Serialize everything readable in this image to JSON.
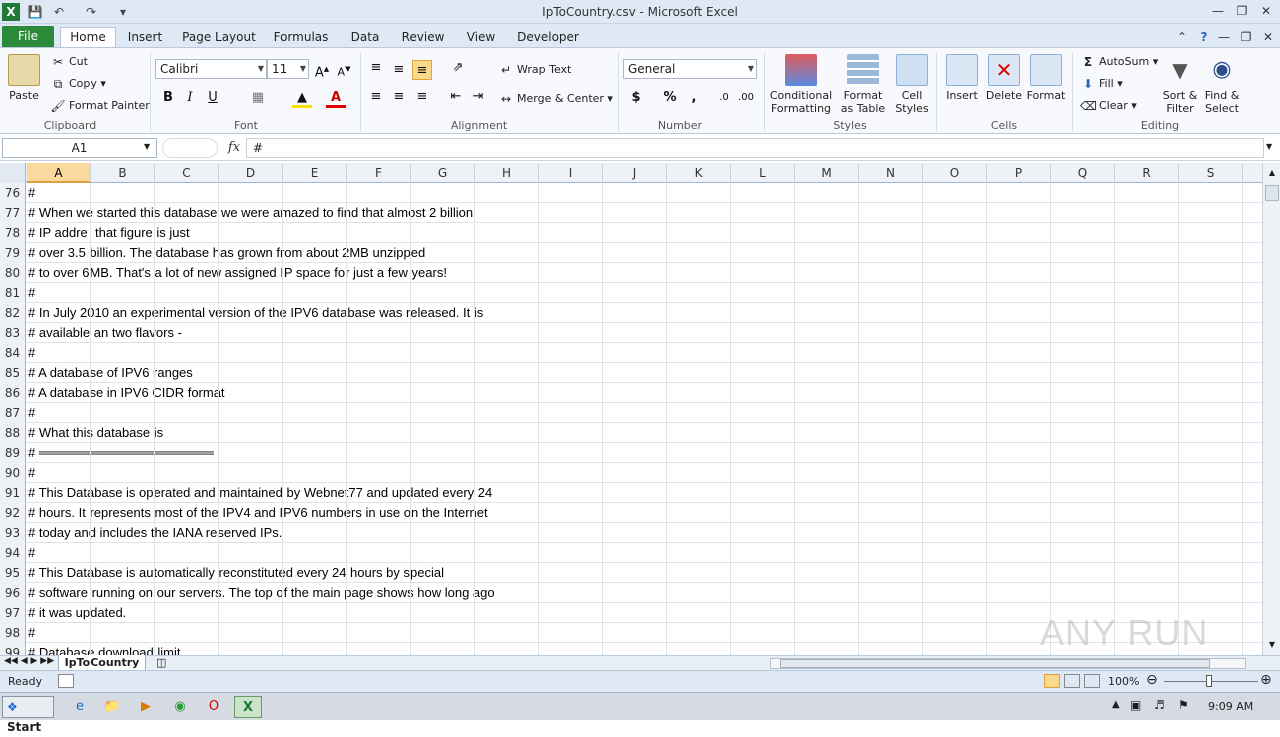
{
  "window": {
    "title": "IpToCountry.csv  -  Microsoft Excel"
  },
  "tabs": [
    {
      "label": "File"
    },
    {
      "label": "Home"
    },
    {
      "label": "Insert"
    },
    {
      "label": "Page Layout"
    },
    {
      "label": "Formulas"
    },
    {
      "label": "Data"
    },
    {
      "label": "Review"
    },
    {
      "label": "View"
    },
    {
      "label": "Developer"
    }
  ],
  "ribbon": {
    "clipboard": {
      "paste": "Paste",
      "cut": "Cut",
      "copy": "Copy",
      "format_painter": "Format Painter",
      "label": "Clipboard"
    },
    "font": {
      "name": "Calibri",
      "size": "11",
      "label": "Font"
    },
    "alignment": {
      "wrap_text": "Wrap Text",
      "merge_center": "Merge & Center",
      "label": "Alignment"
    },
    "number": {
      "format": "General",
      "label": "Number"
    },
    "styles": {
      "conditional": "Conditional",
      "conditional2": "Formatting",
      "format_as": "Format",
      "format_as2": "as Table",
      "cell": "Cell",
      "cell2": "Styles",
      "label": "Styles"
    },
    "cells": {
      "insert": "Insert",
      "delete": "Delete",
      "format": "Format",
      "label": "Cells"
    },
    "editing": {
      "autosum": "AutoSum",
      "fill": "Fill",
      "clear": "Clear",
      "sort": "Sort &",
      "sort2": "Filter",
      "find": "Find &",
      "find2": "Select",
      "label": "Editing"
    }
  },
  "formula_bar": {
    "name_box": "A1",
    "fx": "fx",
    "formula": "#"
  },
  "columns": [
    "A",
    "B",
    "C",
    "D",
    "E",
    "F",
    "G",
    "H",
    "I",
    "J",
    "K",
    "L",
    "M",
    "N",
    "O",
    "P",
    "Q",
    "R",
    "S"
  ],
  "rows": [
    {
      "num": "76",
      "text": "#"
    },
    {
      "num": "77",
      "text": "# When we started this database we were amazed to find that almost 2 billion"
    },
    {
      "num": "78",
      "text": "# IP addre  that figure is just"
    },
    {
      "num": "79",
      "text": "# over 3.5 billion. The database has grown from about 2MB unzipped"
    },
    {
      "num": "80",
      "text": "# to over 6MB. That's a lot of new assigned IP space for just a few years!"
    },
    {
      "num": "81",
      "text": "#"
    },
    {
      "num": "82",
      "text": "# In July 2010 an experimental version of the IPV6 database was released. It is"
    },
    {
      "num": "83",
      "text": "# available an two flavors -"
    },
    {
      "num": "84",
      "text": "#"
    },
    {
      "num": "85",
      "text": "# A database of IPV6 ranges"
    },
    {
      "num": "86",
      "text": "# A database in IPV6 CIDR format"
    },
    {
      "num": "87",
      "text": "#"
    },
    {
      "num": "88",
      "text": "# What this database is"
    },
    {
      "num": "89",
      "text": "# ═══════════════════"
    },
    {
      "num": "90",
      "text": "#"
    },
    {
      "num": "91",
      "text": "# This Database is operated and maintained by Webnet77 and updated every 24"
    },
    {
      "num": "92",
      "text": "# hours. It represents most of the IPV4 and IPV6 numbers in use on the Internet"
    },
    {
      "num": "93",
      "text": "# today and includes the IANA reserved IPs."
    },
    {
      "num": "94",
      "text": "#"
    },
    {
      "num": "95",
      "text": "# This Database is automatically reconstituted every 24 hours by special"
    },
    {
      "num": "96",
      "text": "# software running on our servers. The top of the main page shows how long ago"
    },
    {
      "num": "97",
      "text": "# it was updated."
    },
    {
      "num": "98",
      "text": "#"
    },
    {
      "num": "99",
      "text": "# Database download limit"
    }
  ],
  "sheet": {
    "tab": "IpToCountry"
  },
  "status": {
    "ready": "Ready",
    "zoom": "100%"
  },
  "taskbar": {
    "start": "Start",
    "time": "9:09 AM"
  },
  "watermark": "ANY RUN"
}
